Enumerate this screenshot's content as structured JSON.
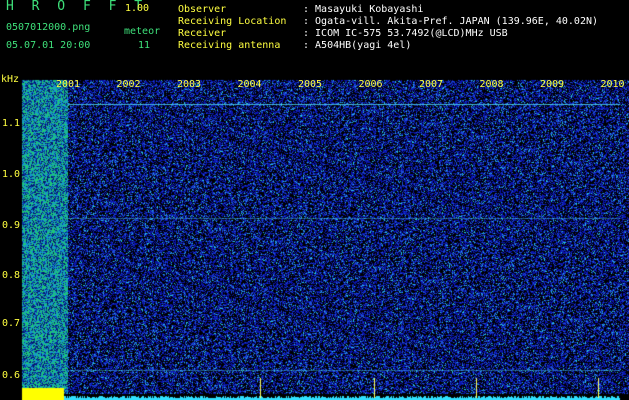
{
  "app": {
    "title": "H R O F F T",
    "version": "1.00"
  },
  "file": {
    "name": "0507012000.png",
    "timestamp": "05.07.01 20:00"
  },
  "meteor": {
    "label": "meteor",
    "count": "11"
  },
  "info": [
    {
      "key": "Observer",
      "value": ": Masayuki Kobayashi"
    },
    {
      "key": "Receiving Location",
      "value": ": Ogata-vill. Akita-Pref. JAPAN (139.96E, 40.02N)"
    },
    {
      "key": "Receiver",
      "value": ": ICOM IC-575 53.7492(@LCD)MHz USB"
    },
    {
      "key": "Receiving antenna",
      "value": ": A504HB(yagi 4el)"
    }
  ],
  "axis": {
    "y_unit": "kHz",
    "y_ticks": [
      "1.1",
      "1.0",
      "0.9",
      "0.8",
      "0.7",
      "0.6"
    ],
    "x_ticks": [
      "2001",
      "2002",
      "2003",
      "2004",
      "2005",
      "2006",
      "2007",
      "2008",
      "2009",
      "2010"
    ]
  },
  "colors": {
    "label": "#ffff40",
    "green": "#3ee07a",
    "noise": "#1020a0",
    "signal": "#30e0ff"
  }
}
